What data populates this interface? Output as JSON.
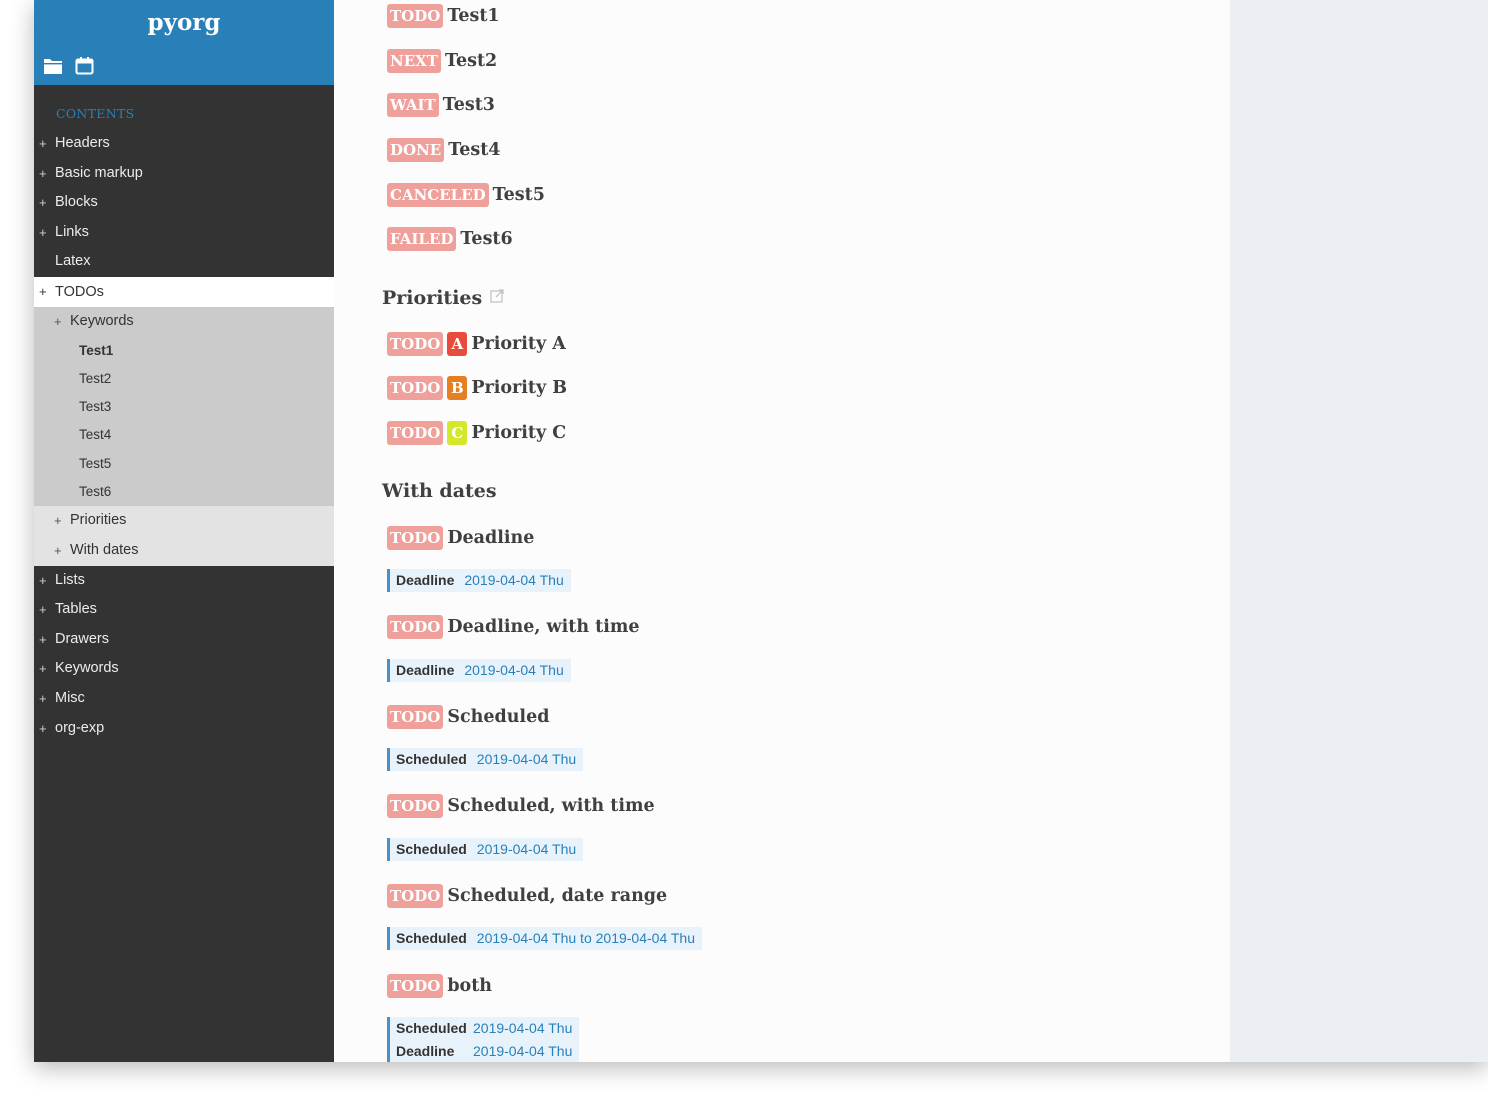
{
  "app": {
    "title": "pyorg"
  },
  "sidebar": {
    "icons": [
      "folder-icon",
      "calendar-icon"
    ],
    "contents_label": "CONTENTS",
    "items": [
      {
        "label": "Headers",
        "plus": "+"
      },
      {
        "label": "Basic markup",
        "plus": "+"
      },
      {
        "label": "Blocks",
        "plus": "+"
      },
      {
        "label": "Links",
        "plus": "+"
      },
      {
        "label": "Latex",
        "plus": ""
      },
      {
        "label": "TODOs",
        "plus": "+",
        "active": true
      },
      {
        "label": "Keywords",
        "plus": "+"
      },
      {
        "label": "Test1"
      },
      {
        "label": "Test2"
      },
      {
        "label": "Test3"
      },
      {
        "label": "Test4"
      },
      {
        "label": "Test5"
      },
      {
        "label": "Test6"
      },
      {
        "label": "Priorities",
        "plus": "+"
      },
      {
        "label": "With dates",
        "plus": "+"
      },
      {
        "label": "Lists",
        "plus": "+"
      },
      {
        "label": "Tables",
        "plus": "+"
      },
      {
        "label": "Drawers",
        "plus": "+"
      },
      {
        "label": "Keywords",
        "plus": "+"
      },
      {
        "label": "Misc",
        "plus": "+"
      },
      {
        "label": "org-exp",
        "plus": "+"
      }
    ]
  },
  "colors": {
    "accent": "#2980b9",
    "keyword_bg": "#f0a09b",
    "priority_a": "#e74c3c",
    "priority_b": "#e67e22",
    "priority_c": "#d4e72b"
  },
  "main": {
    "keyword_items": [
      {
        "kw": "TODO",
        "title": "Test1"
      },
      {
        "kw": "NEXT",
        "title": "Test2"
      },
      {
        "kw": "WAIT",
        "title": "Test3"
      },
      {
        "kw": "DONE",
        "title": "Test4"
      },
      {
        "kw": "CANCELED",
        "title": "Test5"
      },
      {
        "kw": "FAILED",
        "title": "Test6"
      }
    ],
    "priorities_heading": "Priorities",
    "priority_items": [
      {
        "kw": "TODO",
        "priority": "A",
        "title": "Priority A"
      },
      {
        "kw": "TODO",
        "priority": "B",
        "title": "Priority B"
      },
      {
        "kw": "TODO",
        "priority": "C",
        "title": "Priority C"
      }
    ],
    "dates_heading": "With dates",
    "date_items": [
      {
        "kw": "TODO",
        "title": "Deadline",
        "dates": [
          {
            "label": "Deadline",
            "value": "2019-04-04 Thu"
          }
        ]
      },
      {
        "kw": "TODO",
        "title": "Deadline, with time",
        "dates": [
          {
            "label": "Deadline",
            "value": "2019-04-04 Thu"
          }
        ]
      },
      {
        "kw": "TODO",
        "title": "Scheduled",
        "dates": [
          {
            "label": "Scheduled",
            "value": "2019-04-04 Thu"
          }
        ]
      },
      {
        "kw": "TODO",
        "title": "Scheduled, with time",
        "dates": [
          {
            "label": "Scheduled",
            "value": "2019-04-04 Thu"
          }
        ]
      },
      {
        "kw": "TODO",
        "title": "Scheduled, date range",
        "dates": [
          {
            "label": "Scheduled",
            "value": "2019-04-04 Thu to 2019-04-04 Thu"
          }
        ]
      },
      {
        "kw": "TODO",
        "title": "both",
        "dates": [
          {
            "label": "Scheduled",
            "value": "2019-04-04 Thu"
          },
          {
            "label": "Deadline",
            "value": "2019-04-04 Thu"
          }
        ]
      }
    ]
  }
}
